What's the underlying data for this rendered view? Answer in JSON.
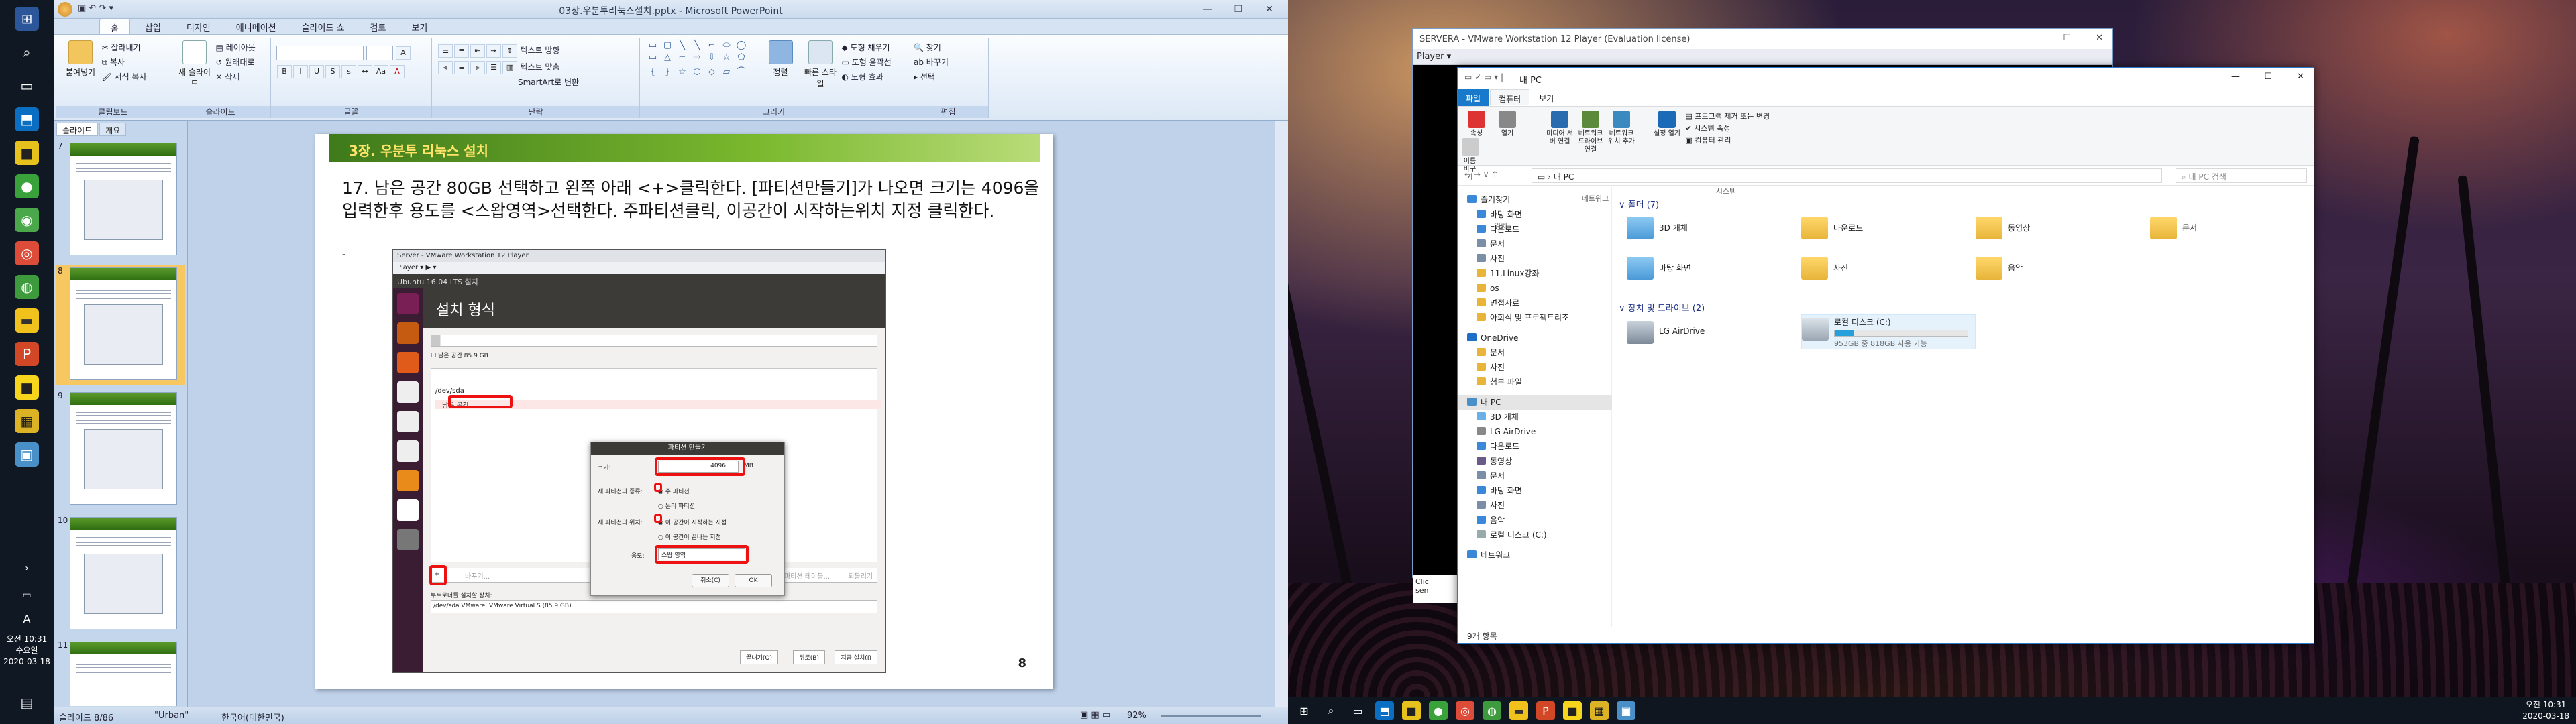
{
  "ppt": {
    "title": "03장.우분투리눅스설치.pptx - Microsoft PowerPoint",
    "tabs": [
      "홈",
      "삽입",
      "디자인",
      "애니메이션",
      "슬라이드 쇼",
      "검토",
      "보기"
    ],
    "ribbon": {
      "paste": "붙여넣기",
      "cut": "잘라내기",
      "copy": "복사",
      "format_painter": "서식 복사",
      "new_slide": "새 슬라이드",
      "layout": "레이아웃",
      "reset": "원래대로",
      "delete": "삭제",
      "text_direction": "텍스트 방향",
      "align_text": "텍스트 맞춤",
      "smartart": "SmartArt로 변환",
      "arrange": "정렬",
      "quick_styles": "빠른 스타일",
      "shape_fill": "도형 채우기",
      "shape_outline": "도형 윤곽선",
      "shape_effects": "도형 효과",
      "find": "찾기",
      "replace": "바꾸기",
      "select": "선택",
      "groups": [
        "클립보드",
        "슬라이드",
        "글꼴",
        "단락",
        "그리기",
        "편집"
      ]
    },
    "left_tabs": [
      "슬라이드",
      "개요"
    ],
    "thumbnails": [
      {
        "num": "7"
      },
      {
        "num": "8"
      },
      {
        "num": "9"
      },
      {
        "num": "10"
      },
      {
        "num": "11"
      }
    ],
    "slide": {
      "header": "3장. 우분투 리눅스 설치",
      "body": "17. 남은 공간 80GB 선택하고 왼쪽 아래 <+>클릭한다. [파티션만들기]가 나오면 크기는 4096을 입력한후 용도를 <스왑영역>선택한다. 주파티션클릭, 이공간이 시작하는위치 지정 클릭한다.",
      "bullet": "-",
      "page_number": "8",
      "shot": {
        "window_title": "Server - VMware Workstation 12 Player",
        "menu": "Player ▾  ▶ ▾",
        "top_bar": "Ubuntu 16.04 LTS 설치",
        "installer_title": "설치 형식",
        "free_space": "남은 공간",
        "free_space_size": "85.9 GB",
        "device": "/dev/sda",
        "partition_row": "남은 공간",
        "dialog_title": "파티션 만들기",
        "dlg_size_label": "크기:",
        "dlg_size_value": "4096",
        "dlg_size_unit": "MB",
        "dlg_type_label": "새 파티션의 종류:",
        "dlg_primary": "주 파티션",
        "dlg_logical": "논리 파티션",
        "dlg_loc_label": "새 파티션의 위치:",
        "dlg_loc_start": "이 공간이 시작하는 지점",
        "dlg_loc_end": "이 공간이 끝나는 지점",
        "dlg_use_label": "용도:",
        "dlg_use_value": "스왑 영역",
        "dlg_cancel": "취소(C)",
        "dlg_ok": "OK",
        "plus": "+",
        "change": "바꾸기...",
        "new_table": "새 파티션 테이블...",
        "revert": "되돌리기",
        "bootloader_label": "부트로더를 설치할 장치:",
        "bootloader_value": "/dev/sda VMware, VMware Virtual S (85.9 GB)",
        "quit": "끝내기(Q)",
        "back": "뒤로(B)",
        "install_now": "지금 설치(I)"
      }
    },
    "status": {
      "slide_info": "슬라이드 8/86",
      "theme": "\"Urban\"",
      "lang": "한국어(대한민국)",
      "zoom": "92%"
    }
  },
  "left_taskbar": {
    "clock_time": "오전 10:31",
    "clock_day": "수요일",
    "clock_date": "2020-03-18",
    "ime": "A"
  },
  "vmware": {
    "title": "SERVERA - VMware Workstation 12 Player (Evaluation license)",
    "menu": "Player ▾",
    "side_text_1": "Clic",
    "side_text_2": "sen"
  },
  "explorer": {
    "title": "내 PC",
    "tabs": [
      "파일",
      "컴퓨터",
      "보기"
    ],
    "ribbon": {
      "properties": "속성",
      "open": "열기",
      "rename": "이름 바꾸기",
      "media_access": "미디어 서버 연결",
      "map_drive": "네트워크 드라이브 연결",
      "add_location": "네트워크 위치 추가",
      "open_settings": "설정 열기",
      "uninstall": "프로그램 제거 또는 변경",
      "system_props": "시스템 속성",
      "manage": "컴퓨터 관리",
      "group_location": "위치",
      "group_network": "네트워크",
      "group_system": "시스템"
    },
    "address": "› 내 PC",
    "search_placeholder": "내 PC 검색",
    "nav": {
      "quick_access": "즐겨찾기",
      "items_quick": [
        "바탕 화면",
        "다운로드",
        "문서",
        "사진",
        "11.Linux강좌",
        "os",
        "면접자료",
        "아회식 및 프로젝트리조"
      ],
      "onedrive": "OneDrive",
      "items_onedrive": [
        "문서",
        "사진",
        "첨부 파일"
      ],
      "thispc": "내 PC",
      "items_pc": [
        "3D 개체",
        "LG AirDrive",
        "다운로드",
        "동영상",
        "문서",
        "바탕 화면",
        "사진",
        "음악",
        "로컬 디스크 (C:)"
      ],
      "network": "네트워크"
    },
    "folders_header": "폴더 (7)",
    "folders": [
      "3D 개체",
      "다운로드",
      "동영상",
      "문서",
      "바탕 화면",
      "사진",
      "음악"
    ],
    "drives_header": "장치 및 드라이브 (2)",
    "drives": [
      {
        "name": "LG AirDrive",
        "free": ""
      },
      {
        "name": "로컬 디스크 (C:)",
        "free": "953GB 중 818GB 사용 가능"
      }
    ],
    "drive_c_used_fraction": 0.14,
    "status": "9개 항목"
  },
  "bottom_taskbar": {
    "clock_time": "오전 10:31",
    "clock_date": "2020-03-18"
  },
  "colors": {
    "ppt_ribbon": "#dce8f6",
    "slide_header_green": "#3f7a1b",
    "slide_header_text": "#ffe46a",
    "highlight_red": "#e11111",
    "explorer_accent": "#1979ca"
  }
}
